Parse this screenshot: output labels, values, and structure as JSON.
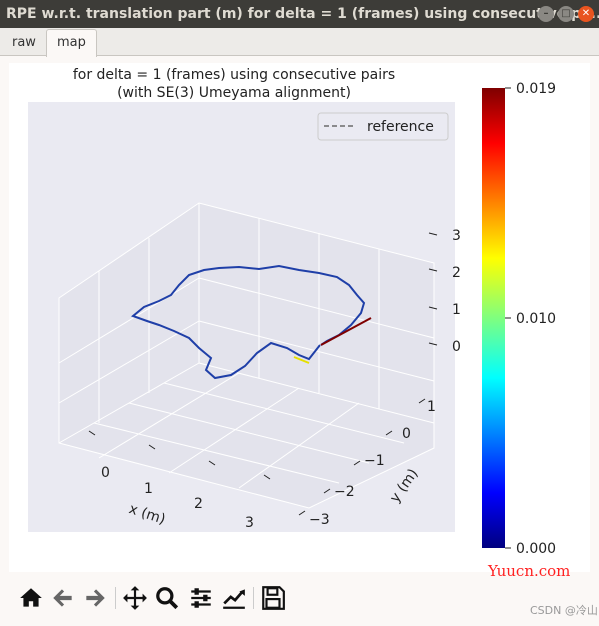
{
  "window": {
    "title": "RPE w.r.t. translation part (m) for delta = 1 (frames) using consecutive pa...",
    "controls": [
      "minimize",
      "maximize",
      "close"
    ]
  },
  "tabs": [
    {
      "label": "raw",
      "active": false
    },
    {
      "label": "map",
      "active": true
    }
  ],
  "plot": {
    "title_line1": "for delta = 1 (frames) using consecutive pairs",
    "title_line2": "(with SE(3) Umeyama alignment)",
    "legend": {
      "label": "reference",
      "style": "dashed",
      "color": "#6b6b6b"
    },
    "xlabel": "x (m)",
    "ylabel": "y (m)",
    "xticks": [
      "0",
      "1",
      "2",
      "3"
    ],
    "yticks": [
      "1",
      "0",
      "−1",
      "−2",
      "−3"
    ],
    "zticks": [
      "3",
      "2",
      "1",
      "0"
    ],
    "colorbar": {
      "colormap": "jet",
      "ticks": [
        "0.019",
        "0.010",
        "0.000"
      ],
      "min": 0.0,
      "max": 0.019
    },
    "pane_color": "#eaeaf2"
  },
  "toolbar": {
    "icons": [
      "home-icon",
      "back-icon",
      "forward-icon",
      "pan-icon",
      "zoom-icon",
      "configure-subplots-icon",
      "edit-axis-icon",
      "save-icon"
    ]
  },
  "watermarks": {
    "site": "Yuucn.com",
    "author": "CSDN @冷山"
  }
}
